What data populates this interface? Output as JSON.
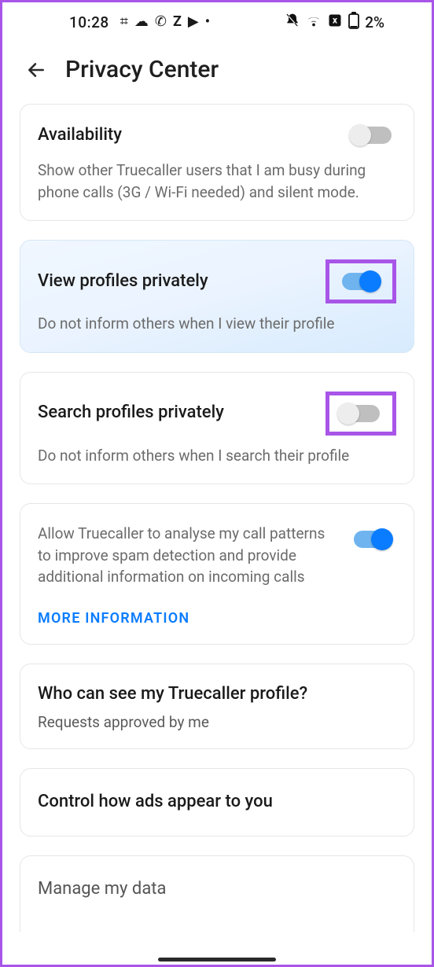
{
  "statusbar": {
    "time": "10:28",
    "left_icons": [
      "hash-icon",
      "speech-icon",
      "whatsapp-icon",
      "z-icon",
      "youtube-icon",
      "dot-icon"
    ],
    "right_icons": [
      "bell-off-icon",
      "wifi-icon",
      "error-icon",
      "battery-icon"
    ],
    "battery_pct": "2%"
  },
  "header": {
    "title": "Privacy Center"
  },
  "cards": {
    "availability": {
      "title": "Availability",
      "desc": "Show other Truecaller users that I am busy during phone calls (3G / Wi-Fi needed) and silent mode."
    },
    "view_private": {
      "title": "View profiles privately",
      "desc": "Do not inform others when I view their profile"
    },
    "search_private": {
      "title": "Search profiles privately",
      "desc": "Do not inform others when I search their profile"
    },
    "analyse": {
      "desc": "Allow Truecaller to analyse my call patterns to improve spam detection and provide additional information on incoming calls",
      "link": "MORE INFORMATION"
    },
    "who_see": {
      "title": "Who can see my Truecaller profile?",
      "value": "Requests approved by me"
    },
    "ads": {
      "title": "Control how ads appear to you"
    },
    "manage": {
      "title": "Manage my data"
    }
  }
}
